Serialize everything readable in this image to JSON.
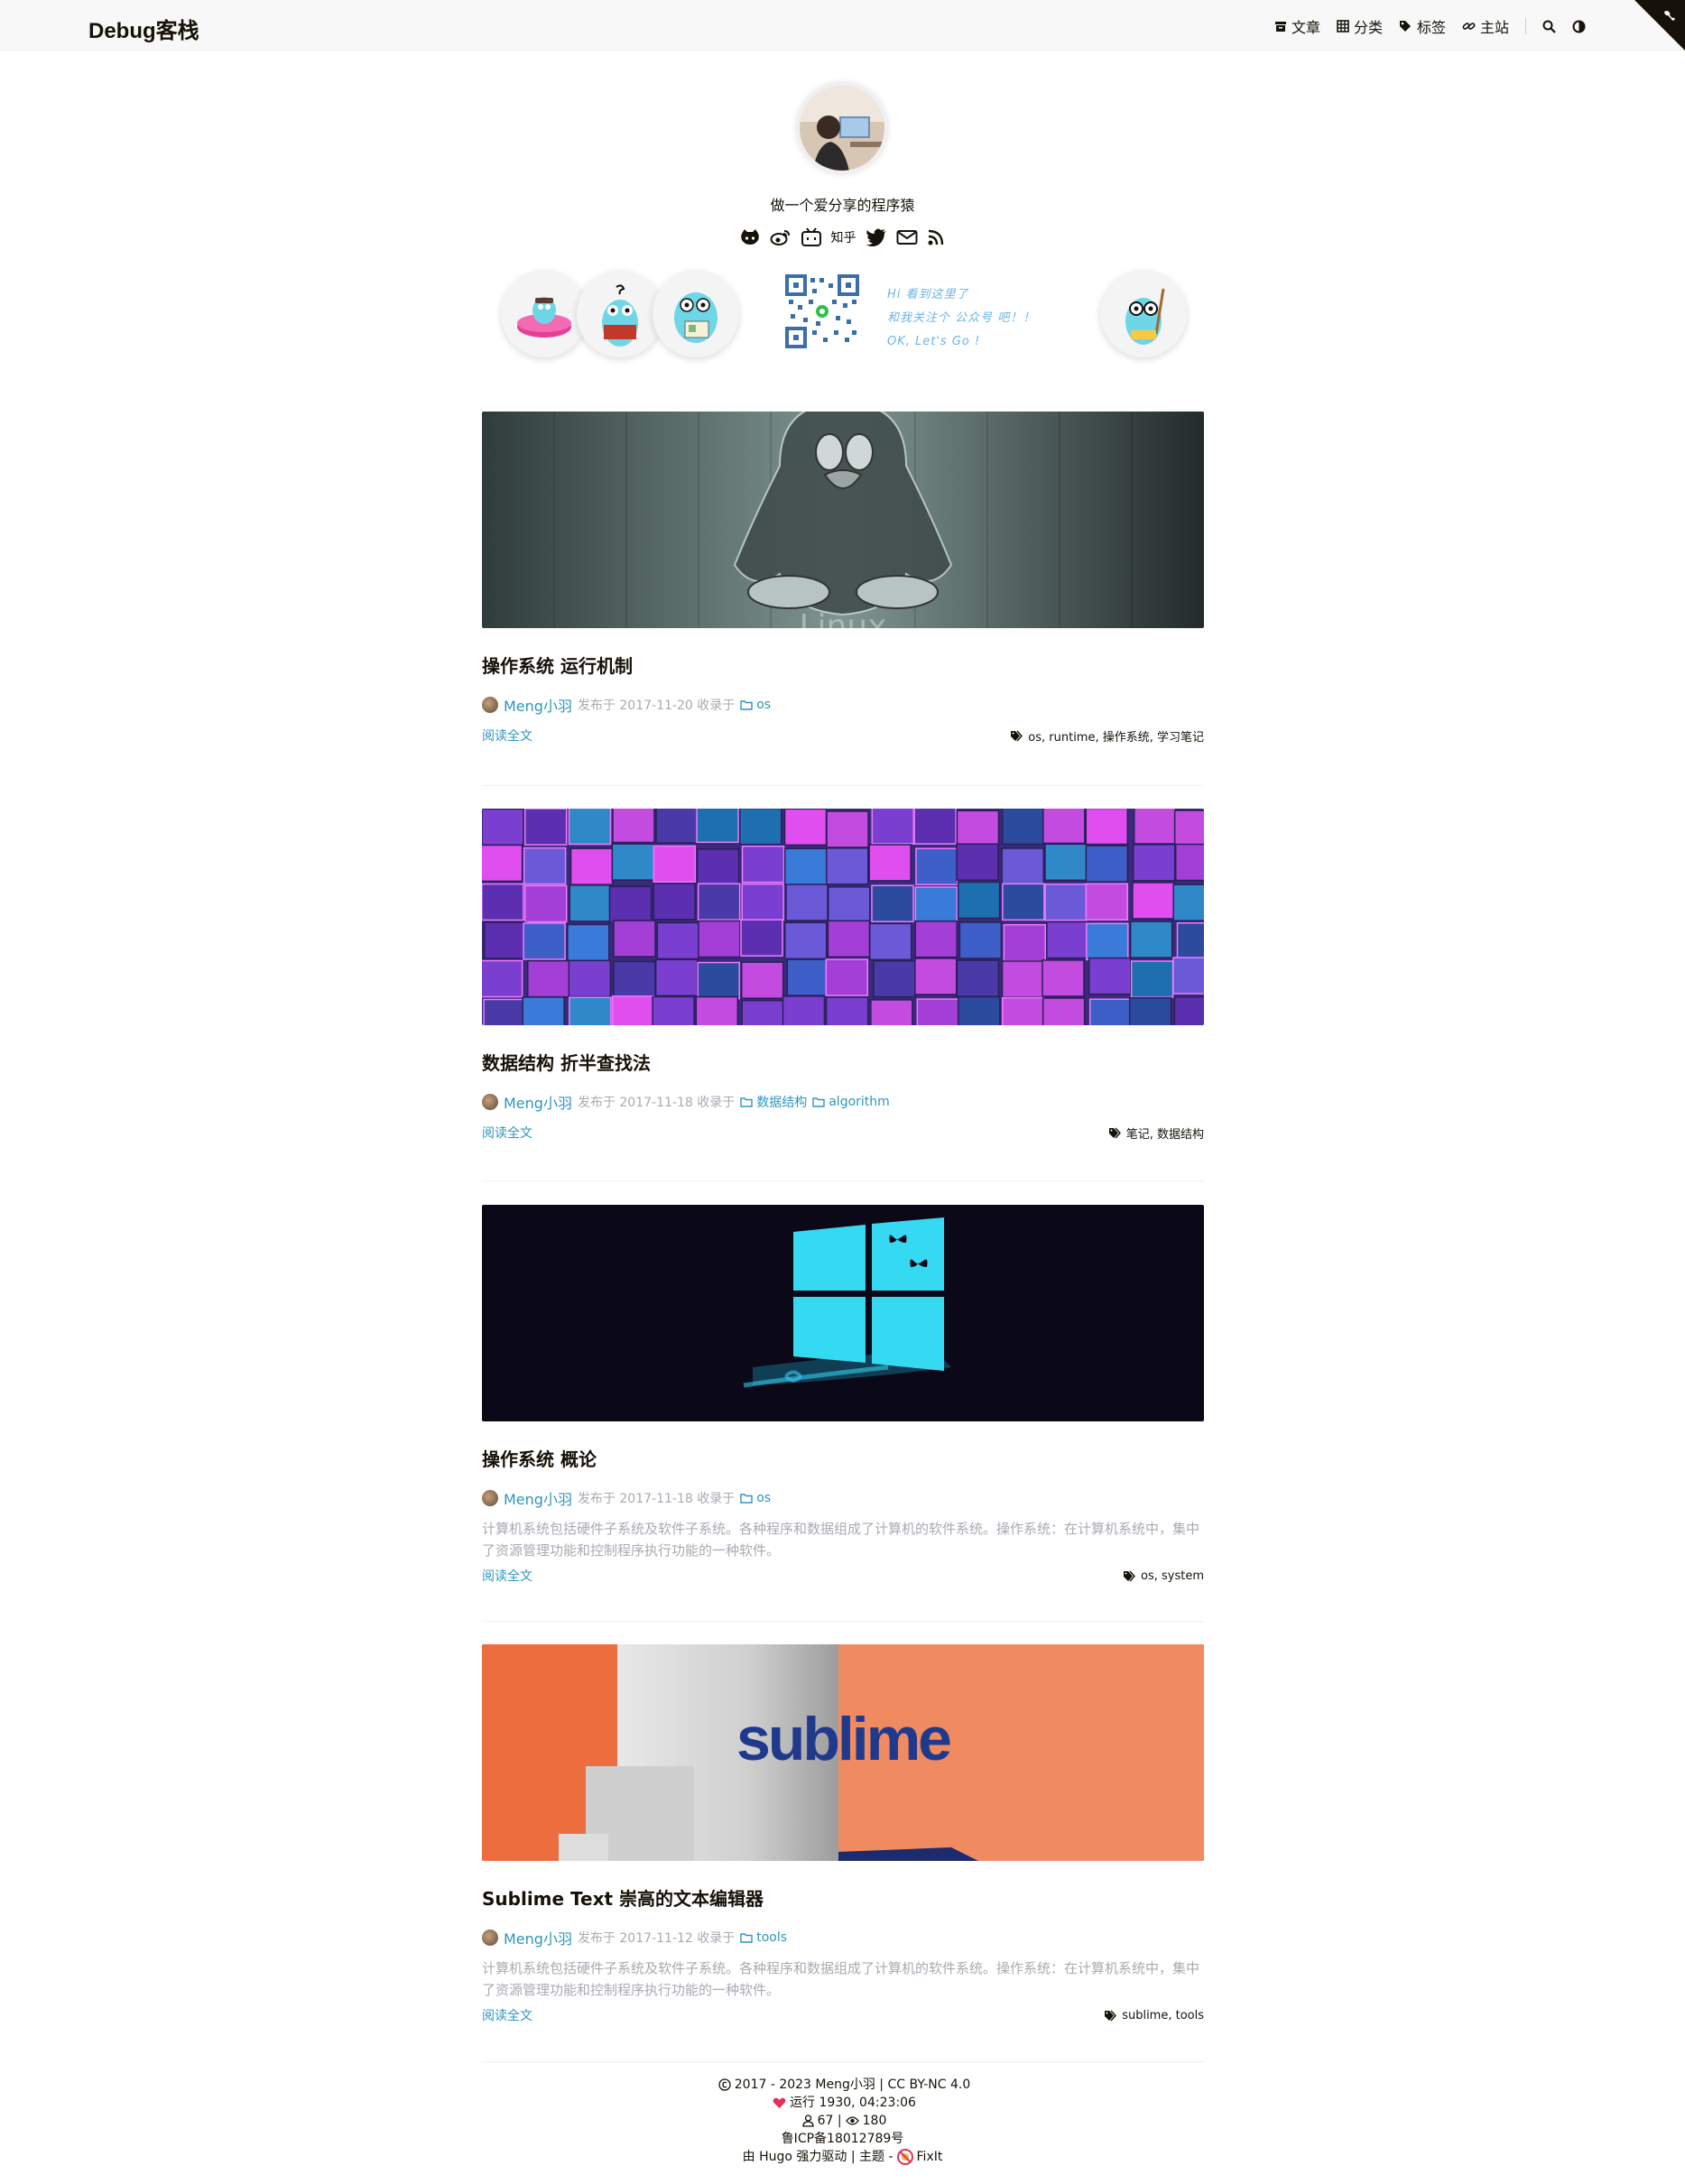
{
  "site": {
    "logo": "Debug客栈",
    "subtitle": "做一个爱分享的程序猿"
  },
  "nav": {
    "items": [
      {
        "label": "文章",
        "icon": "archive-icon"
      },
      {
        "label": "分类",
        "icon": "grid-icon"
      },
      {
        "label": "标签",
        "icon": "tags-icon"
      },
      {
        "label": "主站",
        "icon": "link-icon"
      }
    ]
  },
  "social": {
    "zhihu": "知乎"
  },
  "promo": {
    "line1": "Hi 看到这里了",
    "line2": "和我关注个 公众号 吧！！",
    "line3": "OK, Let's Go !"
  },
  "posts": [
    {
      "title": "操作系统 运行机制",
      "author": "Meng小羽",
      "published": "发布于 2017-11-20 收录于",
      "categories": [
        "os"
      ],
      "summary": "",
      "read_more": "阅读全文",
      "tags": "os, runtime, 操作系统, 学习笔记"
    },
    {
      "title": "数据结构 折半查找法",
      "author": "Meng小羽",
      "published": "发布于 2017-11-18 收录于",
      "categories": [
        "数据结构",
        "algorithm"
      ],
      "summary": "",
      "read_more": "阅读全文",
      "tags": "笔记, 数据结构"
    },
    {
      "title": "操作系统 概论",
      "author": "Meng小羽",
      "published": "发布于 2017-11-18 收录于",
      "categories": [
        "os"
      ],
      "summary": "计算机系统包括硬件子系统及软件子系统。各种程序和数据组成了计算机的软件系统。操作系统：在计算机系统中，集中了资源管理功能和控制程序执行功能的一种软件。",
      "read_more": "阅读全文",
      "tags": "os, system"
    },
    {
      "title": "Sublime Text 崇高的文本编辑器",
      "author": "Meng小羽",
      "published": "发布于 2017-11-12 收录于",
      "categories": [
        "tools"
      ],
      "summary": "计算机系统包括硬件子系统及软件子系统。各种程序和数据组成了计算机的软件系统。操作系统：在计算机系统中，集中了资源管理功能和控制程序执行功能的一种软件。",
      "read_more": "阅读全文",
      "tags": "sublime, tools"
    }
  ],
  "images": {
    "linux": "Linux",
    "sublime": "sublime"
  },
  "footer": {
    "copyright": "2017 - 2023 Meng小羽 | CC BY-NC 4.0",
    "runtime": "运行 1930, 04:23:06",
    "stats": "67 |",
    "views": "180",
    "icp": "鲁ICP备18012789号",
    "powered": "由 Hugo 强力驱动 | 主题 -",
    "theme": "FixIt"
  }
}
